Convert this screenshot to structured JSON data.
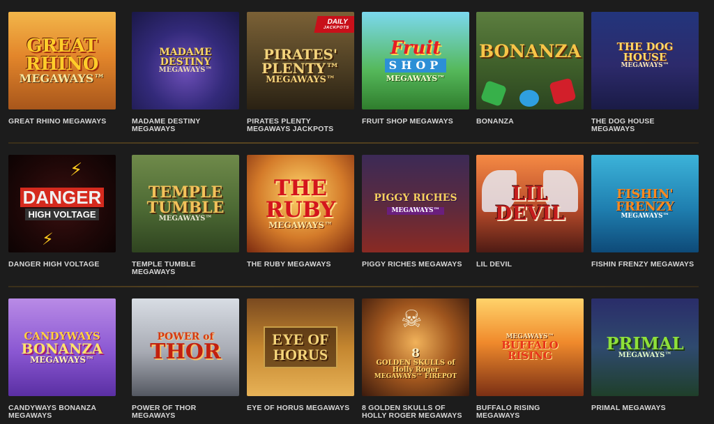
{
  "badges": {
    "daily_line1": "DAILY",
    "daily_line2": "JACKPOTS"
  },
  "rows": [
    {
      "tiles": [
        {
          "title": "GREAT RHINO MEGAWAYS",
          "art": [
            "GREAT",
            "RHINO",
            "MEGAWAYS™"
          ]
        },
        {
          "title": "MADAME DESTINY MEGAWAYS",
          "art": [
            "MADAME DESTINY",
            "MEGAWAYS™"
          ]
        },
        {
          "title": "PIRATES PLENTY MEGAWAYS JACKPOTS",
          "art": [
            "PIRATES'",
            "PLENTY™",
            "MEGAWAYS™"
          ]
        },
        {
          "title": "FRUIT SHOP MEGAWAYS",
          "art": [
            "Fruit",
            "SHOP",
            "MEGAWAYS™"
          ]
        },
        {
          "title": "BONANZA",
          "art": [
            "BONANZA"
          ]
        },
        {
          "title": "THE DOG HOUSE MEGAWAYS",
          "art": [
            "THE DOG HOUSE",
            "MEGAWAYS™"
          ]
        }
      ]
    },
    {
      "tiles": [
        {
          "title": "DANGER HIGH VOLTAGE",
          "art": [
            "DANGER",
            "HIGH VOLTAGE"
          ]
        },
        {
          "title": "TEMPLE TUMBLE MEGAWAYS",
          "art": [
            "TEMPLE",
            "TUMBLE",
            "MEGAWAYS™"
          ]
        },
        {
          "title": "THE RUBY MEGAWAYS",
          "art": [
            "THE",
            "RUBY",
            "MEGAWAYS™"
          ]
        },
        {
          "title": "PIGGY RICHES MEGAWAYS",
          "art": [
            "PIGGY RICHES",
            "MEGAWAYS™"
          ]
        },
        {
          "title": "LIL DEVIL",
          "art": [
            "LIL DEVIL"
          ]
        },
        {
          "title": "FISHIN FRENZY MEGAWAYS",
          "art": [
            "FISHIN'",
            "FRENZY",
            "MEGAWAYS™"
          ]
        }
      ]
    },
    {
      "tiles": [
        {
          "title": "CANDYWAYS BONANZA MEGAWAYS",
          "art": [
            "CANDYWAYS",
            "BONANZA",
            "MEGAWAYS™"
          ]
        },
        {
          "title": "POWER OF THOR MEGAWAYS",
          "art": [
            "POWER of",
            "THOR"
          ]
        },
        {
          "title": "EYE OF HORUS MEGAWAYS",
          "art": [
            "EYE OF",
            "HORUS"
          ]
        },
        {
          "title": "8 GOLDEN SKULLS OF HOLLY ROGER MEGAWAYS",
          "art": [
            "8",
            "GOLDEN SKULLS of Holly Roger",
            "MEGAWAYS™ FIREPOT"
          ]
        },
        {
          "title": "BUFFALO RISING MEGAWAYS",
          "art": [
            "MEGAWAYS™",
            "BUFFALO RISING"
          ]
        },
        {
          "title": "PRIMAL MEGAWAYS",
          "art": [
            "PRIMAL",
            "MEGAWAYS™"
          ]
        }
      ]
    }
  ],
  "colors": {
    "page_background": "#1c1c1c",
    "caption_text": "#d7d7d7",
    "divider": "#5a4620",
    "daily_badge": "#c8101a"
  }
}
